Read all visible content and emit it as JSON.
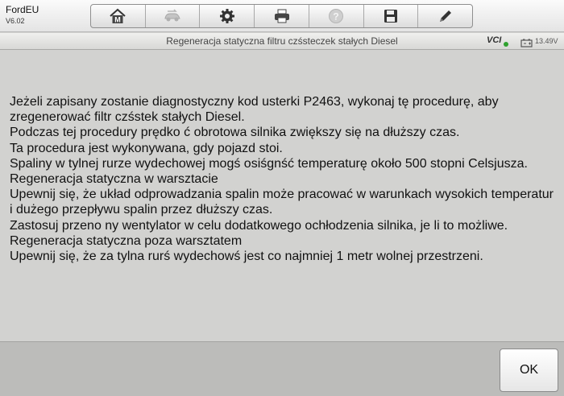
{
  "app": {
    "name": "FordEU",
    "version": "V6.02"
  },
  "toolbar": {
    "buttons": [
      {
        "icon": "home-icon",
        "label": ""
      },
      {
        "icon": "vehicle-swap-icon",
        "label": ""
      },
      {
        "icon": "gear-icon",
        "label": ""
      },
      {
        "icon": "printer-icon",
        "label": ""
      },
      {
        "icon": "help-icon",
        "label": ""
      },
      {
        "icon": "save-icon",
        "label": ""
      },
      {
        "icon": "pencil-icon",
        "label": ""
      }
    ]
  },
  "titlebar": {
    "title": "Regeneracja statyczna filtru czśsteczek stałych Diesel",
    "vci_label": "VCI",
    "vci_status_color": "#2fa12f",
    "voltage": "13.49V"
  },
  "content": {
    "lines": [
      "Jeżeli zapisany zostanie diagnostyczny kod usterki P2463, wykonaj tę procedurę, aby zregenerować filtr czśstek stałych Diesel.",
      "Podczas tej procedury prędko ć obrotowa silnika zwiększy się na dłuższy czas.",
      "Ta procedura jest wykonywana, gdy pojazd stoi.",
      "Spaliny w tylnej rurze wydechowej mogś osiśgnść temperaturę około 500 stopni Celsjusza.",
      "Regeneracja statyczna w warsztacie",
      "Upewnij się, że układ odprowadzania spalin może pracować w warunkach wysokich temperatur i dużego przepływu spalin przez dłuższy czas.",
      "Zastosuj przeno ny wentylator w celu dodatkowego ochłodzenia silnika, je li to możliwe.",
      "Regeneracja statyczna poza warsztatem",
      "Upewnij się, że za tylna rurś wydechowś jest co najmniej 1 metr wolnej przestrzeni."
    ]
  },
  "footer": {
    "ok_label": "OK"
  }
}
